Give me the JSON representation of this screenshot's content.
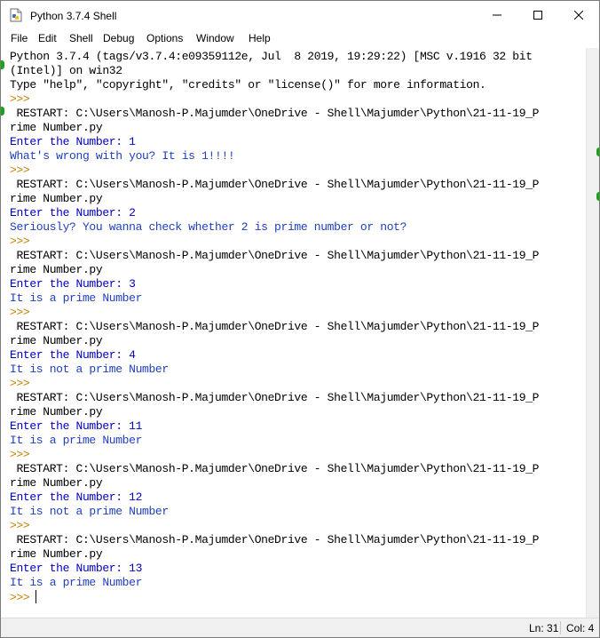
{
  "window": {
    "title": "Python 3.7.4 Shell"
  },
  "menu": {
    "items": [
      "File",
      "Edit",
      "Shell",
      "Debug",
      "Options",
      "Window",
      "Help"
    ]
  },
  "shell": {
    "lines": [
      {
        "text": "Python 3.7.4 (tags/v3.7.4:e09359112e, Jul  8 2019, 19:29:22) [MSC v.1916 32 bit",
        "kind": "out"
      },
      {
        "text": "(Intel)] on win32",
        "kind": "out"
      },
      {
        "text": "Type \"help\", \"copyright\", \"credits\" or \"license()\" for more information.",
        "kind": "out"
      },
      {
        "text": ">>>",
        "kind": "prompt"
      },
      {
        "text": " RESTART: C:\\Users\\Manosh-P.Majumder\\OneDrive - Shell\\Majumder\\Python\\21-11-19_P",
        "kind": "out"
      },
      {
        "text": "rime Number.py",
        "kind": "out"
      },
      {
        "text": "Enter the Number: 1",
        "kind": "input"
      },
      {
        "text": "What's wrong with you? It is 1!!!!",
        "kind": "stdout"
      },
      {
        "text": ">>>",
        "kind": "prompt"
      },
      {
        "text": " RESTART: C:\\Users\\Manosh-P.Majumder\\OneDrive - Shell\\Majumder\\Python\\21-11-19_P",
        "kind": "out"
      },
      {
        "text": "rime Number.py",
        "kind": "out"
      },
      {
        "text": "Enter the Number: 2",
        "kind": "input"
      },
      {
        "text": "Seriously? You wanna check whether 2 is prime number or not?",
        "kind": "stdout"
      },
      {
        "text": ">>>",
        "kind": "prompt"
      },
      {
        "text": " RESTART: C:\\Users\\Manosh-P.Majumder\\OneDrive - Shell\\Majumder\\Python\\21-11-19_P",
        "kind": "out"
      },
      {
        "text": "rime Number.py",
        "kind": "out"
      },
      {
        "text": "Enter the Number: 3",
        "kind": "input"
      },
      {
        "text": "It is a prime Number",
        "kind": "stdout"
      },
      {
        "text": ">>>",
        "kind": "prompt"
      },
      {
        "text": " RESTART: C:\\Users\\Manosh-P.Majumder\\OneDrive - Shell\\Majumder\\Python\\21-11-19_P",
        "kind": "out"
      },
      {
        "text": "rime Number.py",
        "kind": "out"
      },
      {
        "text": "Enter the Number: 4",
        "kind": "input"
      },
      {
        "text": "It is not a prime Number",
        "kind": "stdout"
      },
      {
        "text": ">>>",
        "kind": "prompt"
      },
      {
        "text": " RESTART: C:\\Users\\Manosh-P.Majumder\\OneDrive - Shell\\Majumder\\Python\\21-11-19_P",
        "kind": "out"
      },
      {
        "text": "rime Number.py",
        "kind": "out"
      },
      {
        "text": "Enter the Number: 11",
        "kind": "input"
      },
      {
        "text": "It is a prime Number",
        "kind": "stdout"
      },
      {
        "text": ">>>",
        "kind": "prompt"
      },
      {
        "text": " RESTART: C:\\Users\\Manosh-P.Majumder\\OneDrive - Shell\\Majumder\\Python\\21-11-19_P",
        "kind": "out"
      },
      {
        "text": "rime Number.py",
        "kind": "out"
      },
      {
        "text": "Enter the Number: 12",
        "kind": "input"
      },
      {
        "text": "It is not a prime Number",
        "kind": "stdout"
      },
      {
        "text": ">>>",
        "kind": "prompt"
      },
      {
        "text": " RESTART: C:\\Users\\Manosh-P.Majumder\\OneDrive - Shell\\Majumder\\Python\\21-11-19_P",
        "kind": "out"
      },
      {
        "text": "rime Number.py",
        "kind": "out"
      },
      {
        "text": "Enter the Number: 13",
        "kind": "input"
      },
      {
        "text": "It is a prime Number",
        "kind": "stdout"
      },
      {
        "text": ">>>",
        "kind": "prompt"
      }
    ]
  },
  "status": {
    "line": "Ln: 31",
    "column": "Col: 4"
  },
  "icons": {
    "app": "python-idle-icon",
    "minimize": "minimize-icon",
    "maximize": "maximize-icon",
    "close": "close-icon"
  },
  "colors": {
    "prompt": "#c77c02",
    "input": "#0000c0",
    "stdout": "#1f3fbd",
    "marker": "#19a319"
  }
}
